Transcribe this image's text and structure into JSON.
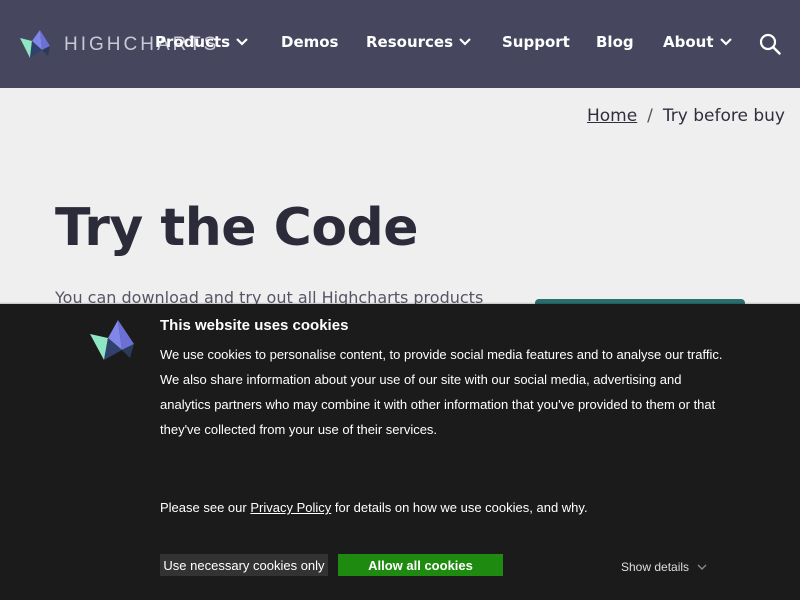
{
  "header": {
    "logo_text": "HIGHCHARTS",
    "nav": [
      {
        "label": "Products",
        "has_dropdown": true
      },
      {
        "label": "Demos",
        "has_dropdown": false
      },
      {
        "label": "Resources",
        "has_dropdown": true
      },
      {
        "label": "Support",
        "has_dropdown": false
      },
      {
        "label": "Blog",
        "has_dropdown": false
      },
      {
        "label": "About",
        "has_dropdown": true
      }
    ],
    "search_icon": "search-icon",
    "background": "#46465e"
  },
  "breadcrumb": {
    "home": "Home",
    "separator": "/",
    "current": "Try before buy"
  },
  "hero": {
    "title": "Try the Code",
    "intro": "You can download and try out all Highcharts products"
  },
  "cookie_banner": {
    "title": "This website uses cookies",
    "body_lines": [
      "We use cookies to personalise content, to provide social media features and to analyse our traffic.",
      "We also share information about your use of our site with our social media, advertising and",
      "analytics partners who may combine it with other information that you've provided to them or that",
      "they've collected from your use of their services."
    ],
    "policy_prefix": "Please see our ",
    "policy_link": "Privacy Policy",
    "policy_suffix": " for details on how we use cookies, and why.",
    "btn_necessary": "Use necessary cookies only",
    "btn_allow": "Allow all cookies",
    "show_details": "Show details",
    "colors": {
      "background": "#1b1b1b",
      "allow": "#1f8a10",
      "necessary": "#333333"
    }
  }
}
